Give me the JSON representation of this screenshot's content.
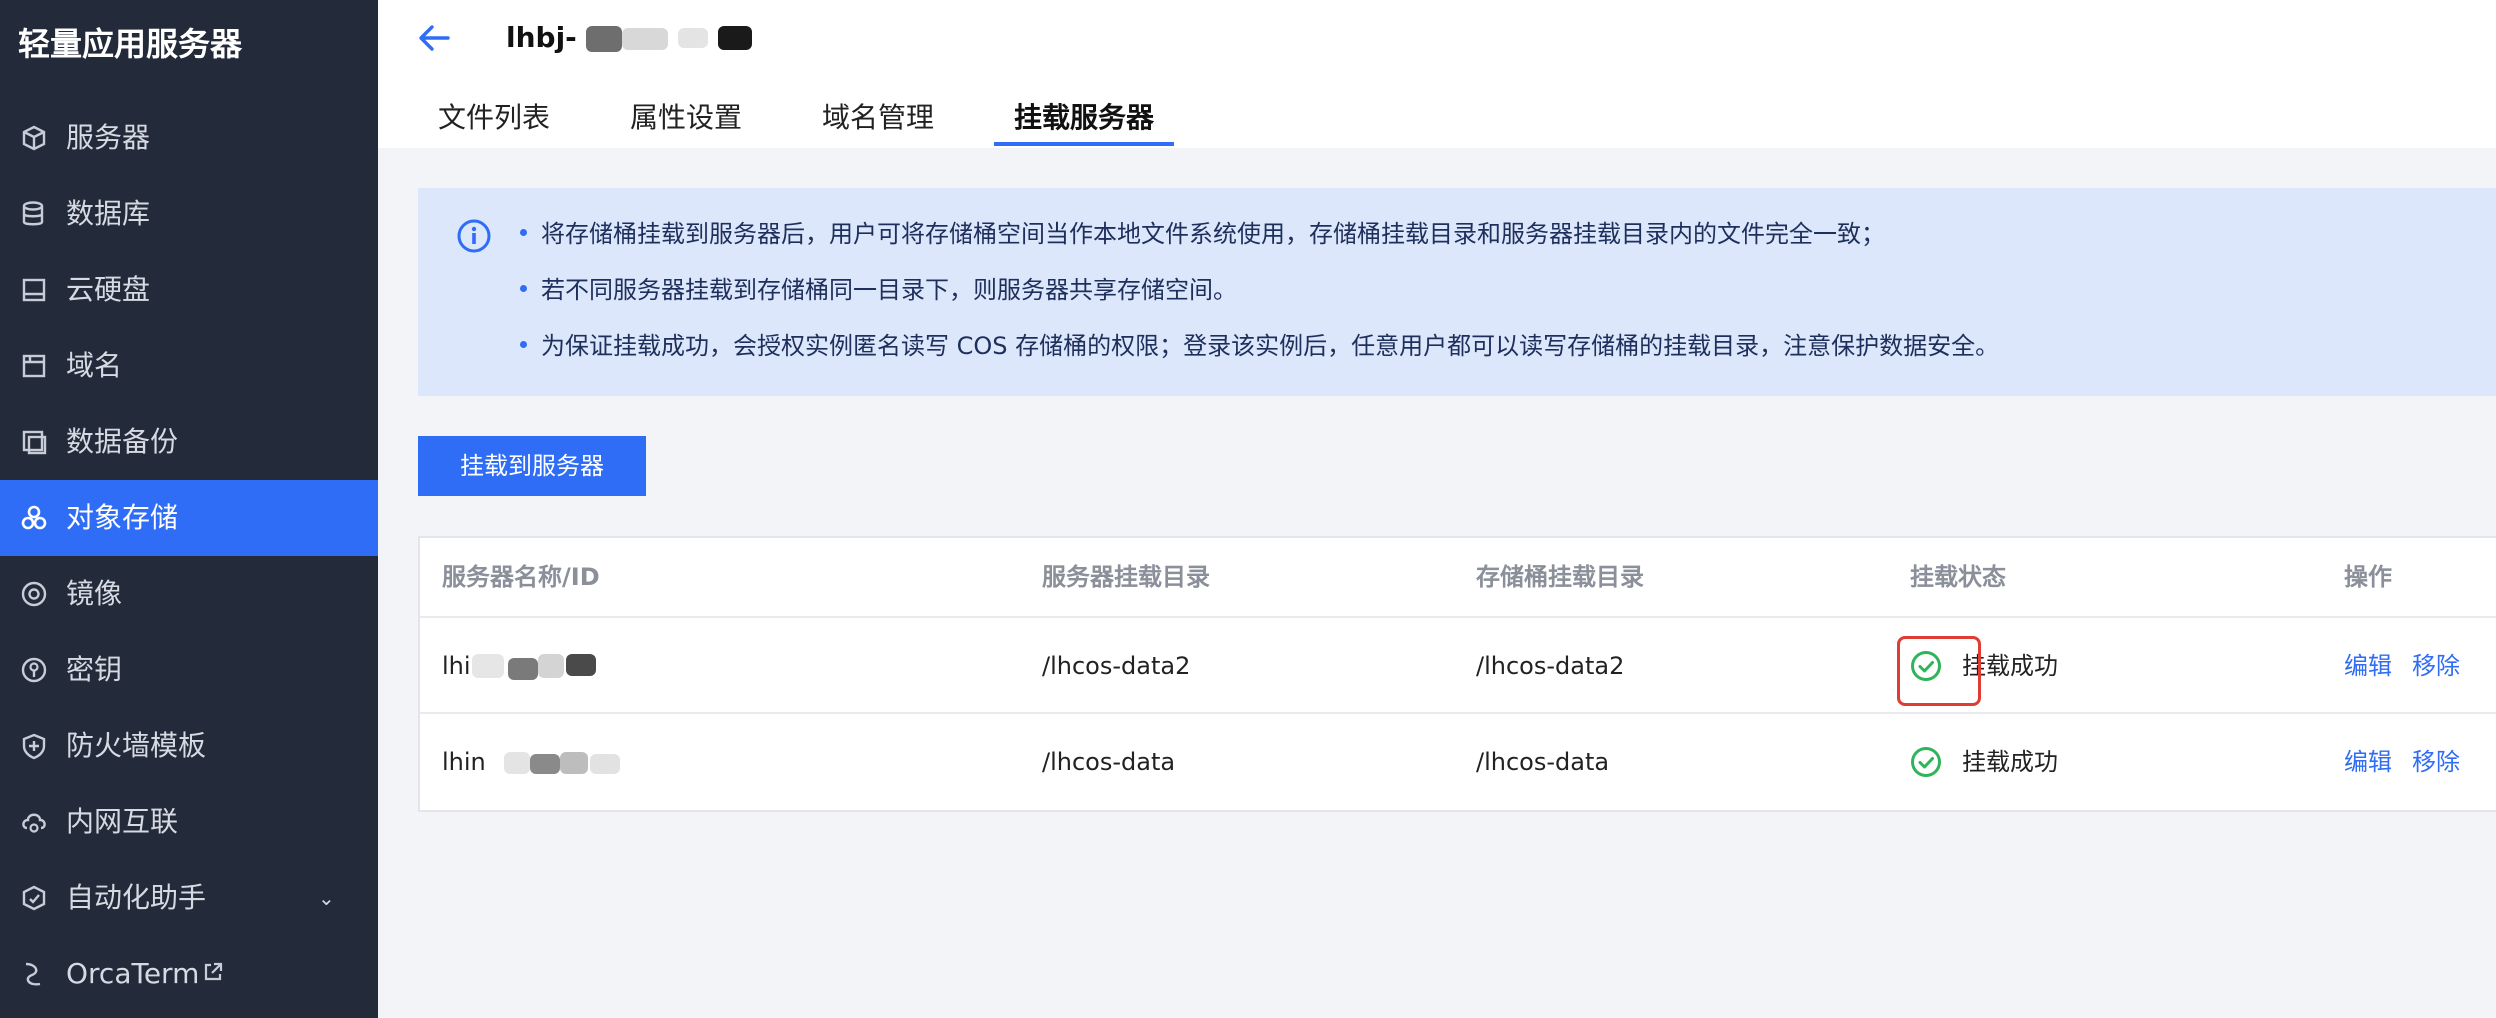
{
  "sidebar": {
    "title": "轻量应用服务器",
    "items": [
      {
        "label": "服务器",
        "icon": "cube-icon"
      },
      {
        "label": "数据库",
        "icon": "database-icon"
      },
      {
        "label": "云硬盘",
        "icon": "disk-icon"
      },
      {
        "label": "域名",
        "icon": "domain-icon"
      },
      {
        "label": "数据备份",
        "icon": "backup-icon"
      },
      {
        "label": "对象存储",
        "icon": "object-storage-icon",
        "active": true
      },
      {
        "label": "镜像",
        "icon": "image-icon"
      },
      {
        "label": "密钥",
        "icon": "key-icon"
      },
      {
        "label": "防火墙模板",
        "icon": "shield-icon"
      },
      {
        "label": "内网互联",
        "icon": "network-icon"
      },
      {
        "label": "自动化助手",
        "icon": "automation-icon",
        "expandable": true
      },
      {
        "label": "OrcaTerm",
        "icon": "terminal-icon",
        "external": true
      }
    ]
  },
  "header": {
    "title": "lhbj-",
    "tabs": [
      {
        "label": "文件列表"
      },
      {
        "label": "属性设置"
      },
      {
        "label": "域名管理"
      },
      {
        "label": "挂载服务器",
        "active": true
      }
    ]
  },
  "notice": {
    "lines": [
      "将存储桶挂载到服务器后，用户可将存储桶空间当作本地文件系统使用，存储桶挂载目录和服务器挂载目录内的文件完全一致；",
      "若不同服务器挂载到存储桶同一目录下，则服务器共享存储空间。",
      "为保证挂载成功，会授权实例匿名读写 COS 存储桶的权限；登录该实例后，任意用户都可以读写存储桶的挂载目录，注意保护数据安全。"
    ]
  },
  "mount_button": "挂载到服务器",
  "table": {
    "columns": [
      "服务器名称/ID",
      "服务器挂载目录",
      "存储桶挂载目录",
      "挂载状态",
      "操作"
    ],
    "rows": [
      {
        "server": "lhi",
        "server_dir": "/lhcos-data2",
        "bucket_dir": "/lhcos-data2",
        "status": "挂载成功",
        "edit": "编辑",
        "remove": "移除"
      },
      {
        "server": "lhin",
        "server_dir": "/lhcos-data",
        "bucket_dir": "/lhcos-data",
        "status": "挂载成功",
        "edit": "编辑",
        "remove": "移除"
      }
    ]
  },
  "colors": {
    "sidebar_bg": "#232a3a",
    "accent": "#2f6df6",
    "notice_bg": "#dce7fb",
    "success": "#2fb45c",
    "highlight": "#e03c31"
  }
}
